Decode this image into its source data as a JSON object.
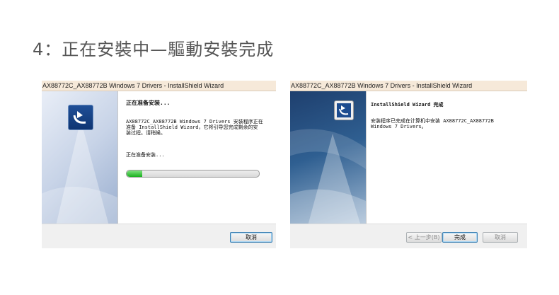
{
  "heading": "4：正在安裝中—驅動安裝完成",
  "left_window": {
    "title": "AX88772C_AX88772B Windows 7 Drivers - InstallShield Wizard",
    "heading": "正在准备安装...",
    "body_line1": "AX88772C_AX88772B Windows 7 Drivers 安装程序正在",
    "body_line2": "准备 InstallShield Wizard，它将引导您完成剩余的安",
    "body_line3": "装过程。请稍候。",
    "status": "正在准备安装...",
    "progress_fraction": 0.12,
    "cancel_label": "取消"
  },
  "right_window": {
    "title": "AX88772C_AX88772B Windows 7 Drivers - InstallShield Wizard",
    "heading": "InstallShield Wizard 完成",
    "body_line1": "安装程序已完成在计算机中安装 AX88772C_AX88772B",
    "body_line2": "Windows 7 Drivers。",
    "back_label": "< 上一步(B)",
    "finish_label": "完成",
    "cancel_label": "取消"
  }
}
